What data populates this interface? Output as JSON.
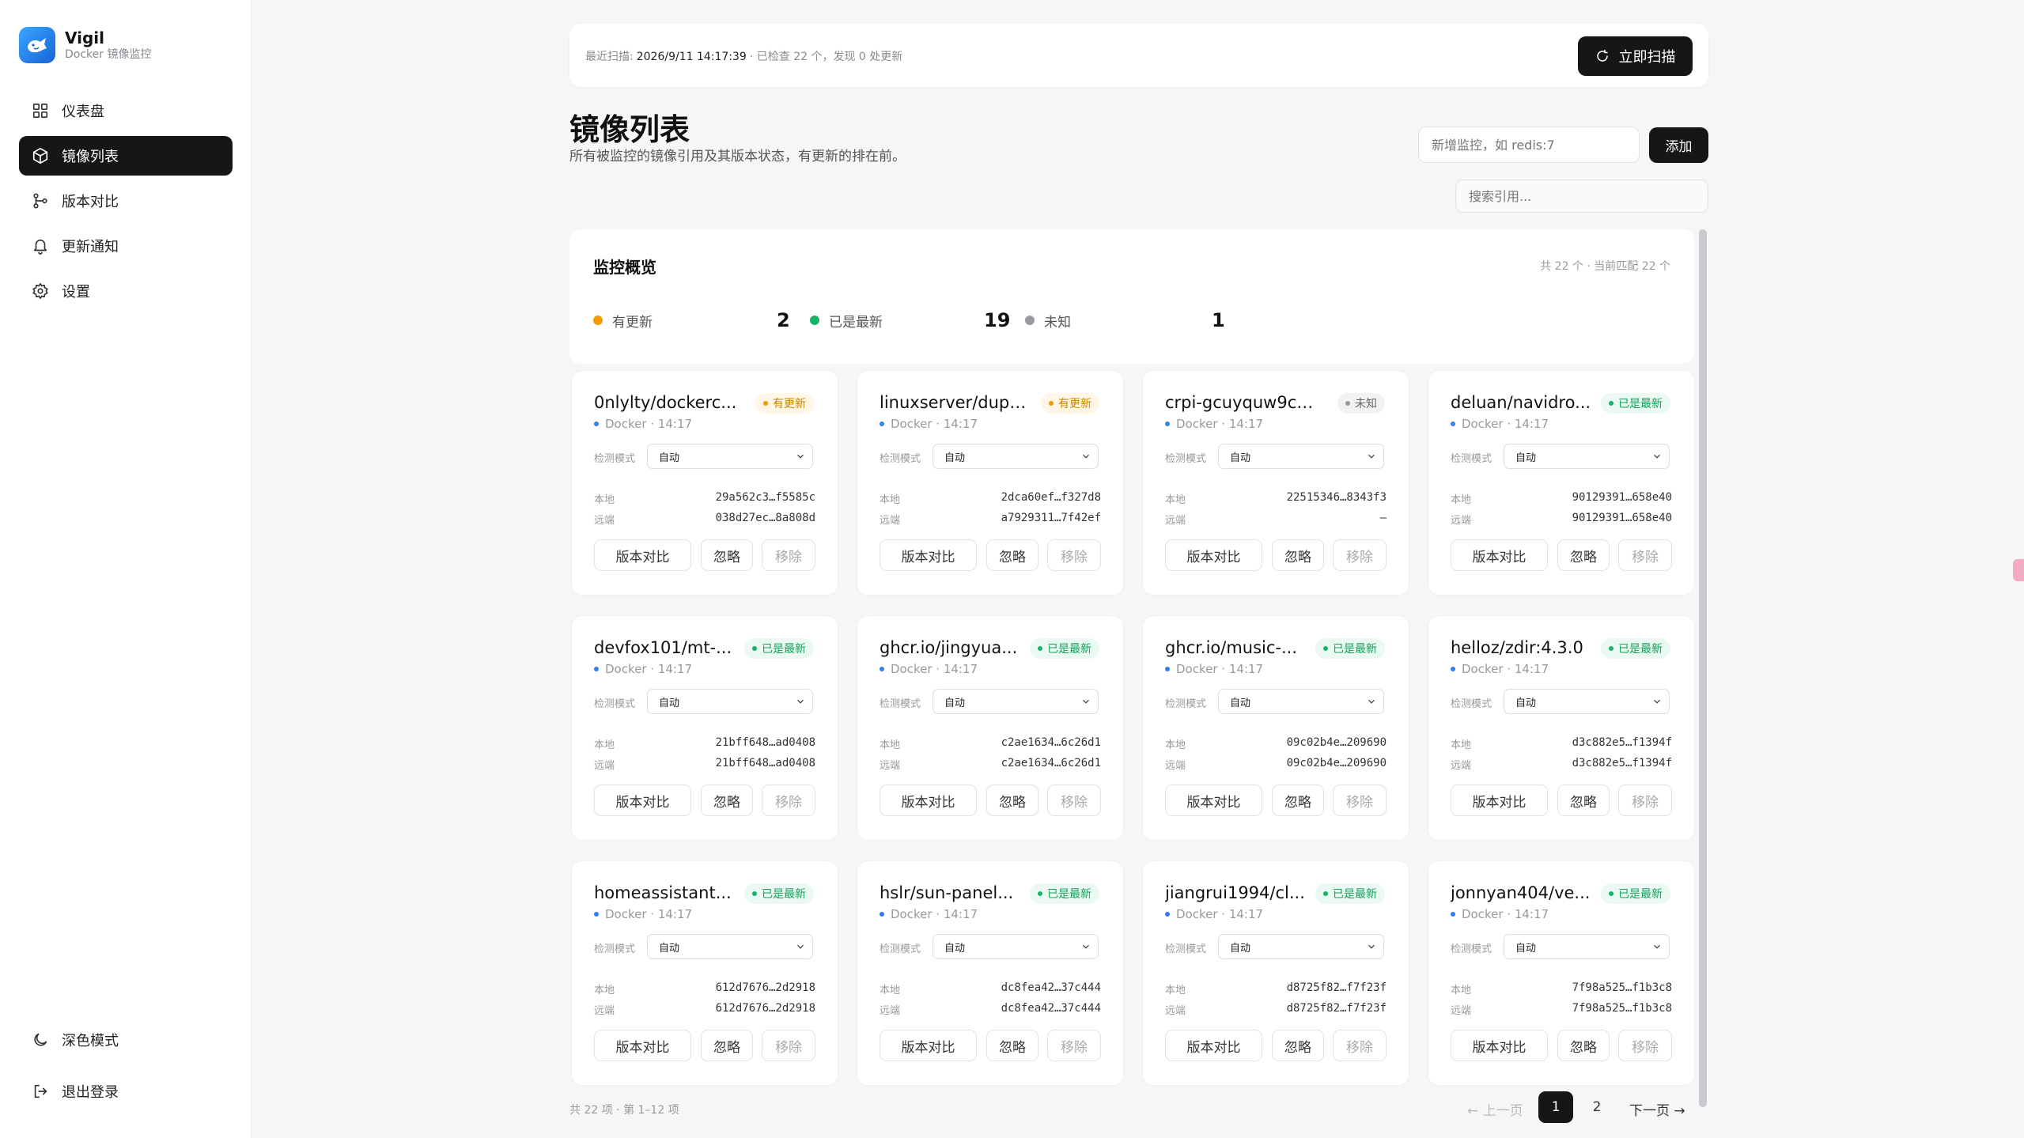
{
  "brand": {
    "name": "Vigil",
    "subtitle": "Docker 镜像监控"
  },
  "nav": [
    {
      "label": "仪表盘",
      "icon": "grid-icon",
      "active": false
    },
    {
      "label": "镜像列表",
      "icon": "cube-icon",
      "active": true
    },
    {
      "label": "版本对比",
      "icon": "branch-icon",
      "active": false
    },
    {
      "label": "更新通知",
      "icon": "bell-icon",
      "active": false
    },
    {
      "label": "设置",
      "icon": "gear-icon",
      "active": false
    }
  ],
  "side_bottom": {
    "dark_mode": "深色模式",
    "logout": "退出登录"
  },
  "topbar": {
    "last_scan_label": "最近扫描:",
    "last_scan_time": "2026/9/11 14:17:39",
    "summary": "· 已检查 22 个，发现 0 处更新",
    "scan_button": "立即扫描"
  },
  "page": {
    "title": "镜像列表",
    "subtitle": "所有被监控的镜像引用及其版本状态，有更新的排在前。",
    "add_placeholder": "新增监控，如 redis:7",
    "add_button": "添加",
    "search_placeholder": "搜索引用..."
  },
  "overview": {
    "title": "监控概览",
    "count_text": "共 22 个 · 当前匹配 22 个",
    "stats": [
      {
        "label": "有更新",
        "value": "2",
        "color": "#f29a00"
      },
      {
        "label": "已是最新",
        "value": "19",
        "color": "#1ab26a"
      },
      {
        "label": "未知",
        "value": "1",
        "color": "#9a9aa0"
      }
    ]
  },
  "card_labels": {
    "source": "Docker",
    "mode_label": "检测模式",
    "mode_value": "自动",
    "local": "本地",
    "remote": "远端",
    "compare": "版本对比",
    "ignore": "忽略",
    "remove": "移除"
  },
  "cards": [
    {
      "name": "0nlylty/dockerc...",
      "status": "update",
      "status_label": "有更新",
      "time": "14:17",
      "local": "29a562c3…f5585c",
      "remote": "038d27ec…8a808d"
    },
    {
      "name": "linuxserver/dupli...",
      "status": "update",
      "status_label": "有更新",
      "time": "14:17",
      "local": "2dca60ef…f327d8",
      "remote": "a7929311…7f42ef"
    },
    {
      "name": "crpi-gcuyquw9co...",
      "status": "unknown",
      "status_label": "未知",
      "time": "14:17",
      "local": "22515346…8343f3",
      "remote": "—"
    },
    {
      "name": "deluan/navidro...",
      "status": "latest",
      "status_label": "已是最新",
      "time": "14:17",
      "local": "90129391…658e40",
      "remote": "90129391…658e40"
    },
    {
      "name": "devfox101/mt-...",
      "status": "latest",
      "status_label": "已是最新",
      "time": "14:17",
      "local": "21bff648…ad0408",
      "remote": "21bff648…ad0408"
    },
    {
      "name": "ghcr.io/jingyua...",
      "status": "latest",
      "status_label": "已是最新",
      "time": "14:17",
      "local": "c2ae1634…6c26d1",
      "remote": "c2ae1634…6c26d1"
    },
    {
      "name": "ghcr.io/music-...",
      "status": "latest",
      "status_label": "已是最新",
      "time": "14:17",
      "local": "09c02b4e…209690",
      "remote": "09c02b4e…209690"
    },
    {
      "name": "helloz/zdir:4.3.0",
      "status": "latest",
      "status_label": "已是最新",
      "time": "14:17",
      "local": "d3c882e5…f1394f",
      "remote": "d3c882e5…f1394f"
    },
    {
      "name": "homeassistant...",
      "status": "latest",
      "status_label": "已是最新",
      "time": "14:17",
      "local": "612d7676…2d2918",
      "remote": "612d7676…2d2918"
    },
    {
      "name": "hslr/sun-panel...",
      "status": "latest",
      "status_label": "已是最新",
      "time": "14:17",
      "local": "dc8fea42…37c444",
      "remote": "dc8fea42…37c444"
    },
    {
      "name": "jiangrui1994/cl...",
      "status": "latest",
      "status_label": "已是最新",
      "time": "14:17",
      "local": "d8725f82…f7f23f",
      "remote": "d8725f82…f7f23f"
    },
    {
      "name": "jonnyan404/ve...",
      "status": "latest",
      "status_label": "已是最新",
      "time": "14:17",
      "local": "7f98a525…f1b3c8",
      "remote": "7f98a525…f1b3c8"
    }
  ],
  "pagination": {
    "info": "共 22 项 · 第 1–12 项",
    "prev": "← 上一页",
    "pages": [
      "1",
      "2"
    ],
    "next": "下一页 →"
  }
}
